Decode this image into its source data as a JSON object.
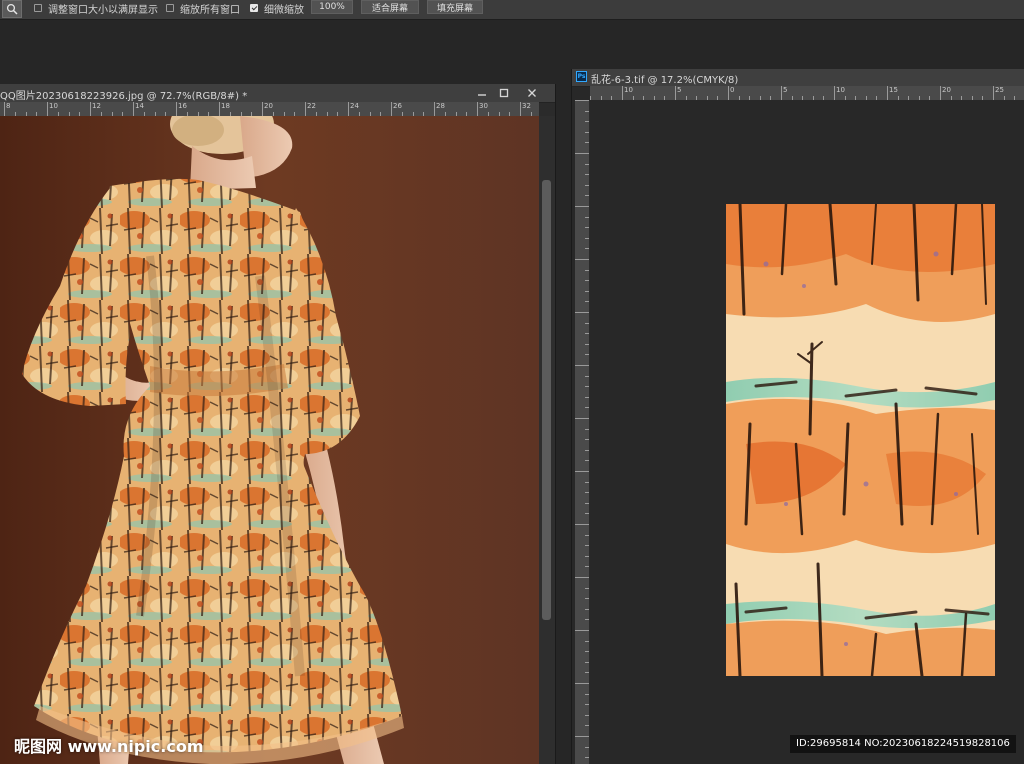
{
  "options_bar": {
    "tool_icon": "zoom-icon",
    "options": [
      {
        "label": "调整窗口大小以满屏显示",
        "checked": false
      },
      {
        "label": "缩放所有窗口",
        "checked": false
      },
      {
        "label": "细微缩放",
        "checked": true
      }
    ],
    "zoom_value": "100%",
    "fit_screen_label": "适合屏幕",
    "fill_screen_label": "填充屏幕"
  },
  "doc1": {
    "title": "QQ图片20230618223926.jpg @ 72.7%(RGB/8#) *",
    "controls": {
      "minimize": "—",
      "restore": "□",
      "close": "✕"
    },
    "ruler_labels": [
      "8",
      "10",
      "12",
      "14",
      "16",
      "18",
      "20",
      "22",
      "24",
      "26",
      "28",
      "30",
      "32"
    ]
  },
  "doc2": {
    "app_icon_text": "Ps",
    "title": "乱花-6-3.tif @ 17.2%(CMYK/8)",
    "ruler_labels": [
      "10",
      "5",
      "0",
      "5",
      "10",
      "15",
      "20",
      "25"
    ]
  },
  "watermark": {
    "site": "昵图网 www.nipic.com",
    "id_text": "ID:29695814 NO:20230618224519828106"
  },
  "colors": {
    "workspace": "#262626",
    "panel": "#3c3c3c",
    "photo_background": "#6a3a26",
    "pattern_base": "#f7dcb2",
    "pattern_orange": "#e8762e",
    "pattern_teal": "#8ccfb8"
  }
}
